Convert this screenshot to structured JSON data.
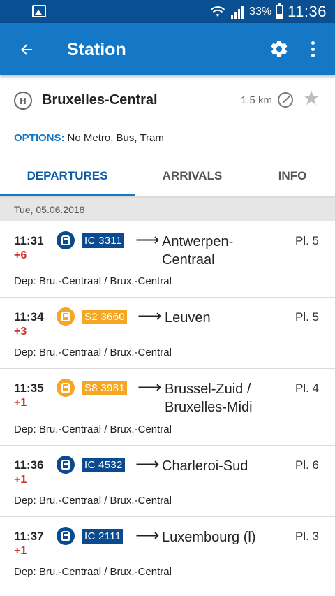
{
  "status_bar": {
    "battery": "33%",
    "time": "11:36"
  },
  "app_bar": {
    "title": "Station"
  },
  "station": {
    "name": "Bruxelles-Central",
    "type_badge": "H",
    "distance": "1.5 km"
  },
  "options": {
    "label": "OPTIONS:",
    "value": "No Metro, Bus, Tram"
  },
  "tabs": [
    {
      "label": "DEPARTURES",
      "active": true
    },
    {
      "label": "ARRIVALS",
      "active": false
    },
    {
      "label": "INFO",
      "active": false
    }
  ],
  "date": "Tue, 05.06.2018",
  "colors": {
    "primary": "#1478c7",
    "status_bar": "#0a4f91",
    "ic_badge": "#0a4a8f",
    "s_badge": "#f5a623",
    "delay": "#d32f2f"
  },
  "departures": [
    {
      "time": "11:31",
      "delay": "+6",
      "train": "IC 3311",
      "train_type": "IC",
      "destination_lines": [
        "Antwerpen-",
        "Centraal"
      ],
      "platform": "Pl. 5",
      "via": "Dep: Bru.-Centraal / Brux.-Central"
    },
    {
      "time": "11:34",
      "delay": "+3",
      "train": "S2 3660",
      "train_type": "S",
      "destination_lines": [
        "Leuven"
      ],
      "platform": "Pl. 5",
      "via": "Dep: Bru.-Centraal / Brux.-Central"
    },
    {
      "time": "11:35",
      "delay": "+1",
      "train": "S8 3981",
      "train_type": "S",
      "destination_lines": [
        "Brussel-Zuid /",
        "Bruxelles-Midi"
      ],
      "platform": "Pl. 4",
      "via": "Dep: Bru.-Centraal / Brux.-Central"
    },
    {
      "time": "11:36",
      "delay": "+1",
      "train": "IC 4532",
      "train_type": "IC",
      "destination_lines": [
        "Charleroi-Sud"
      ],
      "platform": "Pl. 6",
      "via": "Dep: Bru.-Centraal / Brux.-Central"
    },
    {
      "time": "11:37",
      "delay": "+1",
      "train": "IC 2111",
      "train_type": "IC",
      "destination_lines": [
        "Luxembourg (l)"
      ],
      "platform": "Pl. 3",
      "via": "Dep: Bru.-Centraal / Brux.-Central"
    }
  ]
}
